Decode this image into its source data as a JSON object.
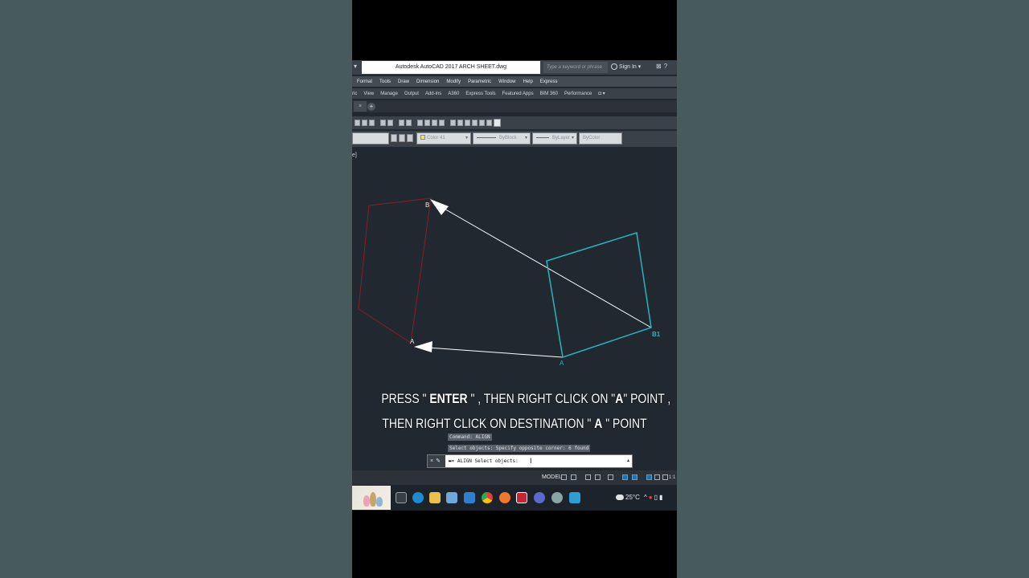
{
  "app": {
    "title": "Autodesk AutoCAD 2017    ARCH SHEET.dwg",
    "search_placeholder": "Type a keyword or phrase",
    "signin_label": "Sign In"
  },
  "menu": {
    "items": [
      "Format",
      "Tools",
      "Draw",
      "Dimension",
      "Modify",
      "Parametric",
      "Window",
      "Help",
      "Express"
    ]
  },
  "ribbon_tabs": {
    "items": [
      "ric",
      "View",
      "Manage",
      "Output",
      "Add-ins",
      "A360",
      "Express Tools",
      "Featured Apps",
      "BIM 360",
      "Performance"
    ]
  },
  "properties": {
    "color": "Color 41",
    "linetype": "ByBlock",
    "lineweight": "ByLayer",
    "plotstyle": "ByColor"
  },
  "viewport": {
    "label": "e]"
  },
  "drawing": {
    "point_labels": {
      "b": "B",
      "a": "A",
      "dest_a": "A",
      "b1": "B1"
    },
    "colors": {
      "source": "#8a1c23",
      "target": "#2bb3bb",
      "arrow": "#ffffff",
      "canvas": "#212830"
    }
  },
  "instruction": {
    "line1_pre": "PRESS \" ",
    "line1_bold": "ENTER",
    "line1_mid": " \" , THEN RIGHT CLICK ON \"",
    "line1_bold2": "A",
    "line1_post": "\" POINT ,",
    "line2_pre": "THEN RIGHT CLICK ON DESTINATION \" ",
    "line2_bold": "A",
    "line2_post": " \"  POINT"
  },
  "command": {
    "history1": "Command: ALIGN",
    "history2": "Select objects: Specify opposite corner: 6 found",
    "current": "ALIGN Select objects:"
  },
  "status": {
    "model": "MODEL",
    "scale": "1:1"
  },
  "taskbar": {
    "temperature": "25°C"
  }
}
